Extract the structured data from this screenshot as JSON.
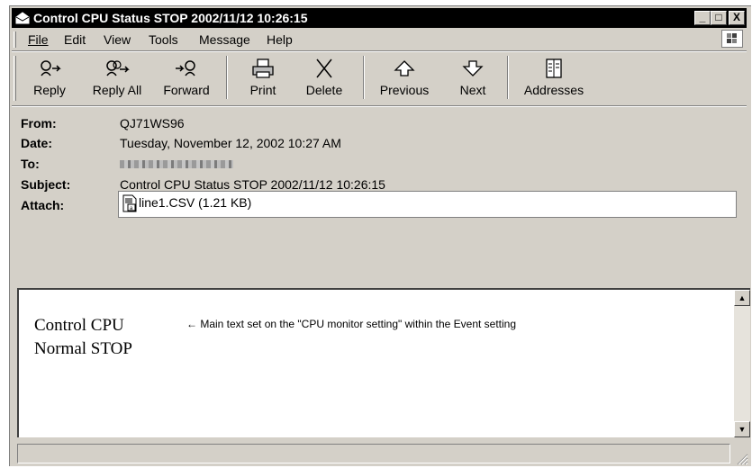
{
  "window": {
    "title": "Control CPU Status STOP 2002/11/12 10:26:15",
    "controls": {
      "minimize": "_",
      "maximize": "□",
      "close": "X"
    }
  },
  "menu": {
    "items": [
      {
        "label": "File",
        "icon": "none"
      },
      {
        "label": "Edit"
      },
      {
        "label": "View"
      },
      {
        "label": "Tools"
      },
      {
        "label": "Message"
      },
      {
        "label": "Help"
      }
    ],
    "throbber_icon": "windows-logo-icon"
  },
  "toolbar": {
    "buttons": [
      {
        "label": "Reply",
        "icon": "reply-icon"
      },
      {
        "label": "Reply All",
        "icon": "reply-all-icon"
      },
      {
        "label": "Forward",
        "icon": "forward-icon"
      },
      {
        "label": "Print",
        "icon": "printer-icon"
      },
      {
        "label": "Delete",
        "icon": "delete-icon"
      },
      {
        "label": "Previous",
        "icon": "up-arrow-icon"
      },
      {
        "label": "Next",
        "icon": "down-arrow-icon"
      },
      {
        "label": "Addresses",
        "icon": "address-book-icon"
      }
    ]
  },
  "header": {
    "from_label": "From:",
    "from_value": "QJ71WS96",
    "date_label": "Date:",
    "date_value": "Tuesday, November 12, 2002 10:27 AM",
    "to_label": "To:",
    "subject_label": "Subject:",
    "subject_value": "Control CPU Status STOP 2002/11/12 10:26:15",
    "attach_label": "Attach:",
    "attachment": "line1.CSV (1.21 KB)"
  },
  "body": {
    "line1": "Control CPU",
    "line2": "Normal STOP",
    "annotation": "← Main text set on the \"CPU monitor setting\" within the Event setting"
  },
  "colors": {
    "chrome": "#d4d0c8",
    "titlebar": "#000000",
    "content_bg": "#ffffff"
  }
}
